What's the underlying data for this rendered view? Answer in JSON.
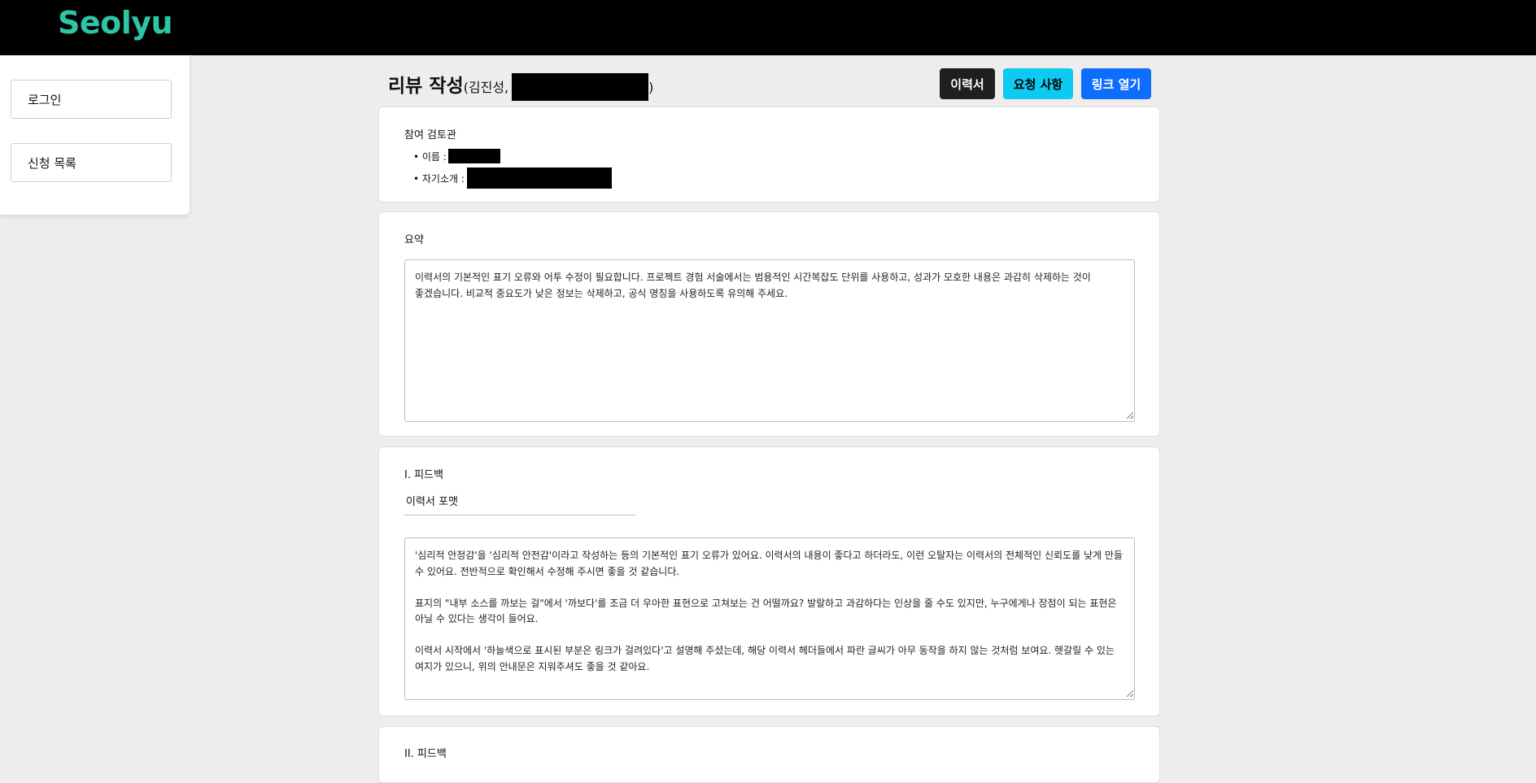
{
  "app": {
    "logo": "Seolyu"
  },
  "sidebar": {
    "items": [
      {
        "label": "로그인"
      },
      {
        "label": "신청 목록"
      }
    ]
  },
  "header": {
    "title": "리뷰 작성",
    "subtitle_prefix": "(김진성,",
    "subtitle_suffix": ")",
    "buttons": {
      "resume": "이력서",
      "requests": "요청 사항",
      "open_link": "링크 열기"
    },
    "colors": {
      "resume": "#1f1f1f",
      "requests": "#0dcaf0",
      "open_link": "#0d6efd"
    }
  },
  "reviewer": {
    "heading": "참여 검토관",
    "name_label": "• 이름 :",
    "intro_label": "• 자기소개 :"
  },
  "summary": {
    "heading": "요약",
    "text": "이력서의 기본적인 표기 오류와 어투 수정이 필요합니다. 프로젝트 경험 서술에서는 범용적인 시간복잡도 단위를 사용하고, 성과가 모호한 내용은 과감히 삭제하는 것이 좋겠습니다. 비교적 중요도가 낮은 정보는 삭제하고, 공식 명칭을 사용하도록 유의해 주세요."
  },
  "feedback1": {
    "heading": "I. 피드백",
    "category": "이력서 포맷",
    "text": "'심리적 안정감'을 '심리적 안전감'이라고 작성하는 등의 기본적인 표기 오류가 있어요. 이력서의 내용이 좋다고 하더라도, 이런 오탈자는 이력서의 전체적인 신뢰도를 낮게 만들 수 있어요. 전반적으로 확인해서 수정해 주시면 좋을 것 같습니다.\n\n표지의 \"내부 소스를 까보는 걸\"에서 '까보다'를 조금 더 우아한 표현으로 고쳐보는 건 어떨까요? 발랄하고 과감하다는 인상을 줄 수도 있지만, 누구에게나 장점이 되는 표현은 아닐 수 있다는 생각이 들어요.\n\n이력서 시작에서 '하늘색으로 표시된 부분은 링크가 걸려있다'고 설명해 주셨는데, 해당 이력서 헤더들에서 파란 글씨가 아무 동작을 하지 않는 것처럼 보여요. 헷갈릴 수 있는 여지가 있으니, 위의 안내문은 지워주셔도 좋을 것 같아요."
  },
  "feedback2": {
    "heading": "II. 피드백"
  }
}
